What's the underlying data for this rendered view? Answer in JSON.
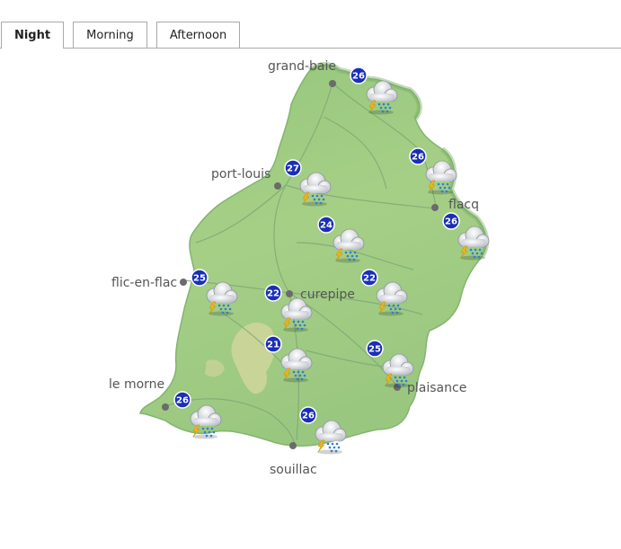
{
  "tabs": [
    {
      "label": "Night",
      "active": true
    },
    {
      "label": "Morning",
      "active": false
    },
    {
      "label": "Afternoon",
      "active": false
    }
  ],
  "towns": [
    {
      "id": "grand-baie",
      "label": "grand-baie"
    },
    {
      "id": "port-louis",
      "label": "port-louis"
    },
    {
      "id": "flacq",
      "label": "flacq"
    },
    {
      "id": "flic-en-flac",
      "label": "flic-en-flac"
    },
    {
      "id": "curepipe",
      "label": "curepipe"
    },
    {
      "id": "le-morne",
      "label": "le morne"
    },
    {
      "id": "plaisance",
      "label": "plaisance"
    },
    {
      "id": "souillac",
      "label": "souillac"
    }
  ],
  "forecasts": [
    {
      "id": "north",
      "temp": "26",
      "icon": "thunderstorm-rain-icon"
    },
    {
      "id": "port-louis",
      "temp": "27",
      "icon": "thunderstorm-rain-icon"
    },
    {
      "id": "east-north",
      "temp": "26",
      "icon": "thunderstorm-rain-icon"
    },
    {
      "id": "flacq",
      "temp": "26",
      "icon": "thunderstorm-rain-icon"
    },
    {
      "id": "central-north",
      "temp": "24",
      "icon": "thunderstorm-rain-icon"
    },
    {
      "id": "flic-en-flac",
      "temp": "25",
      "icon": "thunderstorm-rain-icon"
    },
    {
      "id": "curepipe",
      "temp": "22",
      "icon": "thunderstorm-rain-icon"
    },
    {
      "id": "central-east",
      "temp": "22",
      "icon": "thunderstorm-rain-icon"
    },
    {
      "id": "central-south",
      "temp": "21",
      "icon": "thunderstorm-rain-icon"
    },
    {
      "id": "plaisance",
      "temp": "25",
      "icon": "thunderstorm-rain-icon"
    },
    {
      "id": "le-morne",
      "temp": "26",
      "icon": "thunderstorm-rain-icon"
    },
    {
      "id": "souillac",
      "temp": "26",
      "icon": "thunderstorm-rain-icon"
    }
  ],
  "colors": {
    "land": "#9ccb82",
    "land_dark": "#7fb46c",
    "highland": "#c8cf8e",
    "badge": "#1a2fb8",
    "dot": "#6b6b6b"
  }
}
